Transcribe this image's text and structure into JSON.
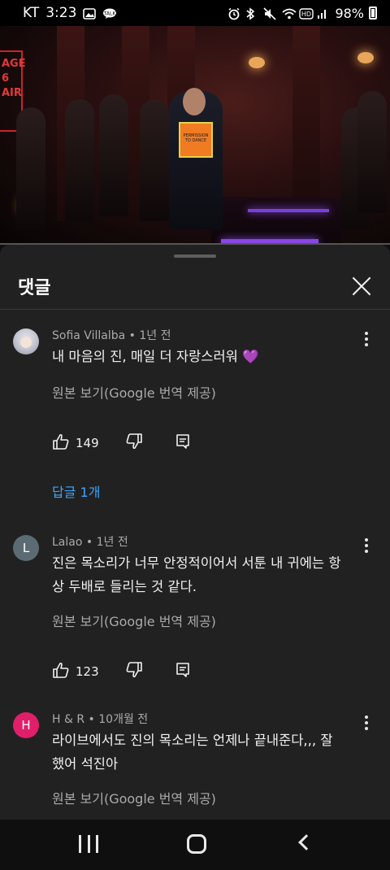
{
  "status_bar": {
    "carrier": "KT",
    "time": "3:23",
    "battery": "98%",
    "left_icons": [
      "gallery-icon",
      "talk-icon"
    ],
    "right_icons": [
      "alarm-icon",
      "bluetooth-icon",
      "mute-icon",
      "wifi-icon",
      "hd-icon",
      "signal-icon"
    ]
  },
  "sheet": {
    "title": "댓글",
    "close_icon": "close-icon"
  },
  "comments": [
    {
      "author": "Sofia Villalba",
      "age": "1년 전",
      "text": "내 마음의 진, 매일 더 자랑스러워 💜",
      "translate": "원본 보기(Google 번역 제공)",
      "likes": "149",
      "replies": "답글 1개",
      "avatar_letter": "",
      "avatar_color": ""
    },
    {
      "author": "Lalao",
      "age": "1년 전",
      "text": "진은 목소리가 너무 안정적이어서 서툰 내 귀에는 항상 두배로 들리는 것 같다.",
      "translate": "원본 보기(Google 번역 제공)",
      "likes": "123",
      "avatar_letter": "L",
      "avatar_color": "#5c6b73"
    },
    {
      "author": "H & R",
      "age": "10개월 전",
      "text": "라이브에서도 진의 목소리는 언제나 끝내준다,,, 잘했어 석진아",
      "translate": "원본 보기(Google 번역 제공)",
      "avatar_letter": "H",
      "avatar_color": "#e01e6a"
    }
  ],
  "video_overlay_text": {
    "sign": "AGE 6 AIR",
    "card": "PERMISSION TO DANCE"
  }
}
